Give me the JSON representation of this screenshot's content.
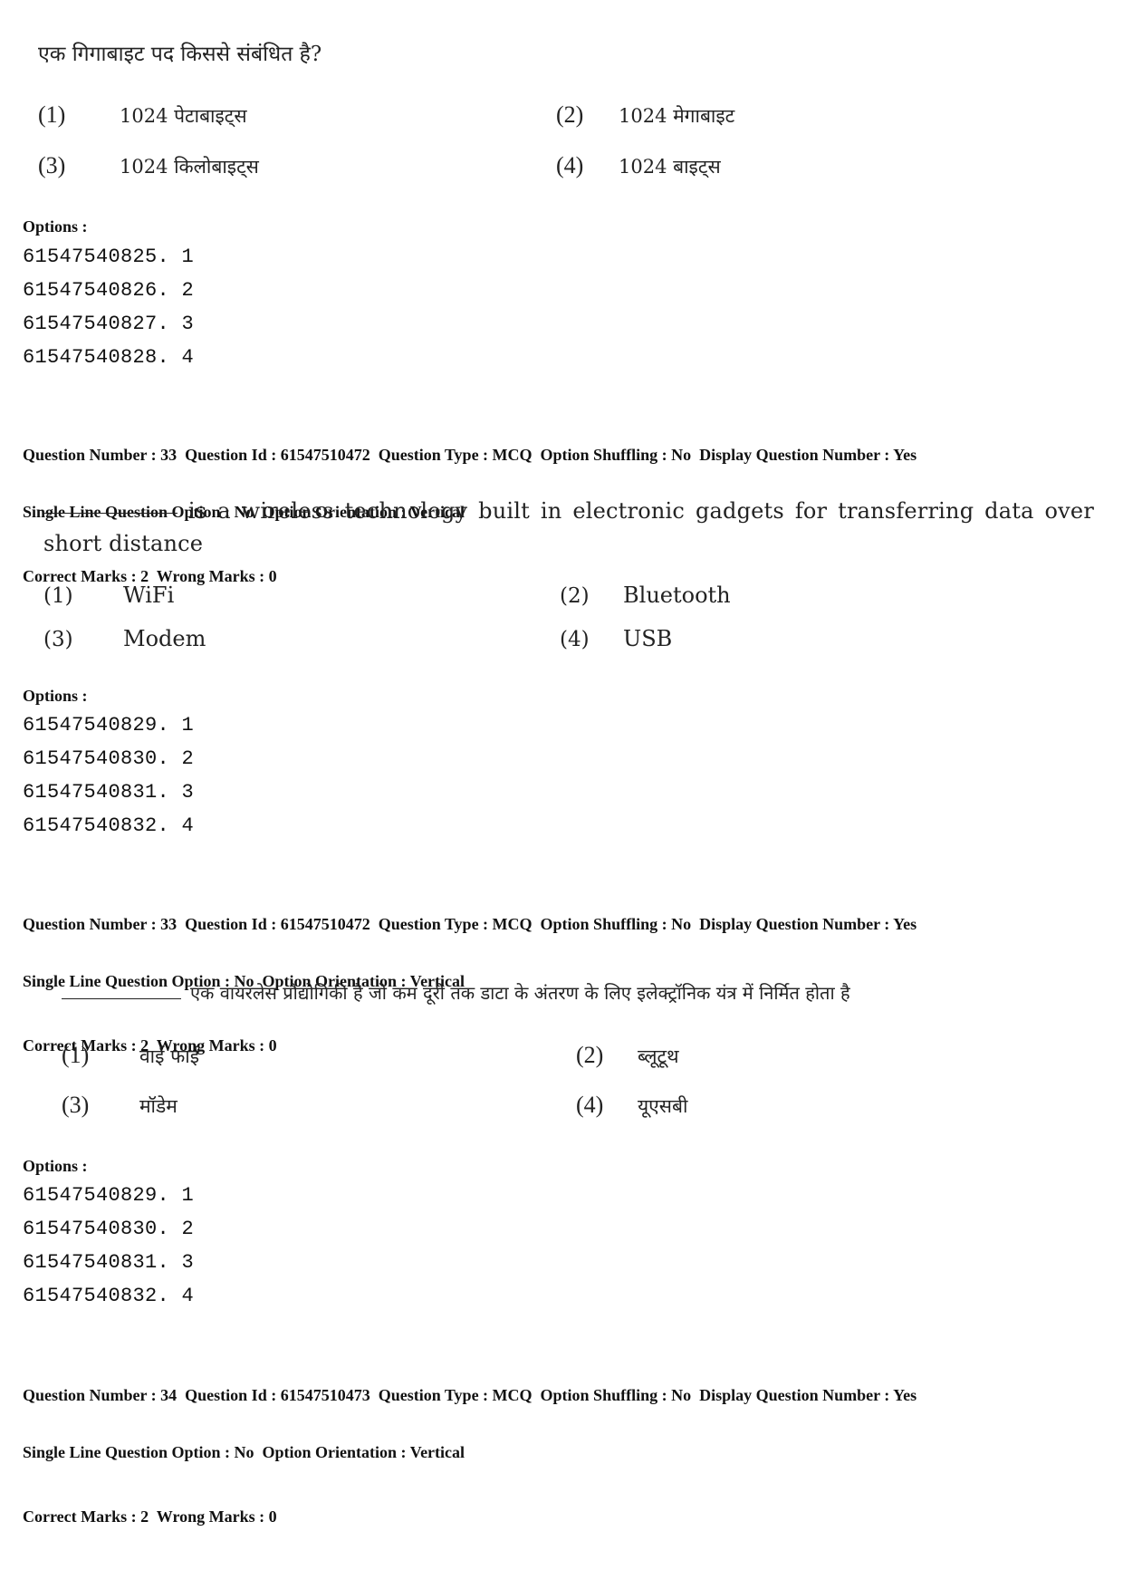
{
  "block1": {
    "question": "एक गिगाबाइट पद किससे संबंधित है?",
    "choices": [
      {
        "num": "(1)",
        "text": "1024 पेटाबाइट्स"
      },
      {
        "num": "(2)",
        "text": "1024 मेगाबाइट"
      },
      {
        "num": "(3)",
        "text": "1024 किलोबाइट्स"
      },
      {
        "num": "(4)",
        "text": "1024 बाइट्स"
      }
    ],
    "options_label": "Options :",
    "option_codes": [
      "61547540825. 1",
      "61547540826. 2",
      "61547540827. 3",
      "61547540828. 4"
    ]
  },
  "block2": {
    "meta_line1": "Question Number : 33  Question Id : 61547510472  Question Type : MCQ  Option Shuffling : No  Display Question Number : Yes",
    "meta_line2": "Single Line Question Option : No  Option Orientation : Vertical",
    "meta_line3": "Correct Marks : 2  Wrong Marks : 0",
    "question_words": [
      "is",
      "a",
      "wireless",
      "technology",
      "built",
      "in",
      "electronic",
      "gadgets",
      "for",
      "transferring",
      "data",
      "over"
    ],
    "question_line2": "short distance",
    "choices": [
      {
        "num": "(1)",
        "text": "WiFi"
      },
      {
        "num": "(2)",
        "text": "Bluetooth"
      },
      {
        "num": "(3)",
        "text": "Modem"
      },
      {
        "num": "(4)",
        "text": "USB"
      }
    ],
    "options_label": "Options :",
    "option_codes": [
      "61547540829. 1",
      "61547540830. 2",
      "61547540831. 3",
      "61547540832. 4"
    ]
  },
  "block3": {
    "meta_line1": "Question Number : 33  Question Id : 61547510472  Question Type : MCQ  Option Shuffling : No  Display Question Number : Yes",
    "meta_line2": "Single Line Question Option : No  Option Orientation : Vertical",
    "meta_line3": "Correct Marks : 2  Wrong Marks : 0",
    "question": "एक वायरलेस प्रौद्योगिकी है जो कम दूरी तक डाटा के अंतरण के लिए इलेक्ट्रॉनिक यंत्र में निर्मित होता है",
    "choices": [
      {
        "num": "(1)",
        "text": "वाई फाई"
      },
      {
        "num": "(2)",
        "text": "ब्लूटूथ"
      },
      {
        "num": "(3)",
        "text": "मॉडेम"
      },
      {
        "num": "(4)",
        "text": "यूएसबी"
      }
    ],
    "options_label": "Options :",
    "option_codes": [
      "61547540829. 1",
      "61547540830. 2",
      "61547540831. 3",
      "61547540832. 4"
    ]
  },
  "block4": {
    "meta_line1": "Question Number : 34  Question Id : 61547510473  Question Type : MCQ  Option Shuffling : No  Display Question Number : Yes",
    "meta_line2": "Single Line Question Option : No  Option Orientation : Vertical",
    "meta_line3": "Correct Marks : 2  Wrong Marks : 0"
  }
}
